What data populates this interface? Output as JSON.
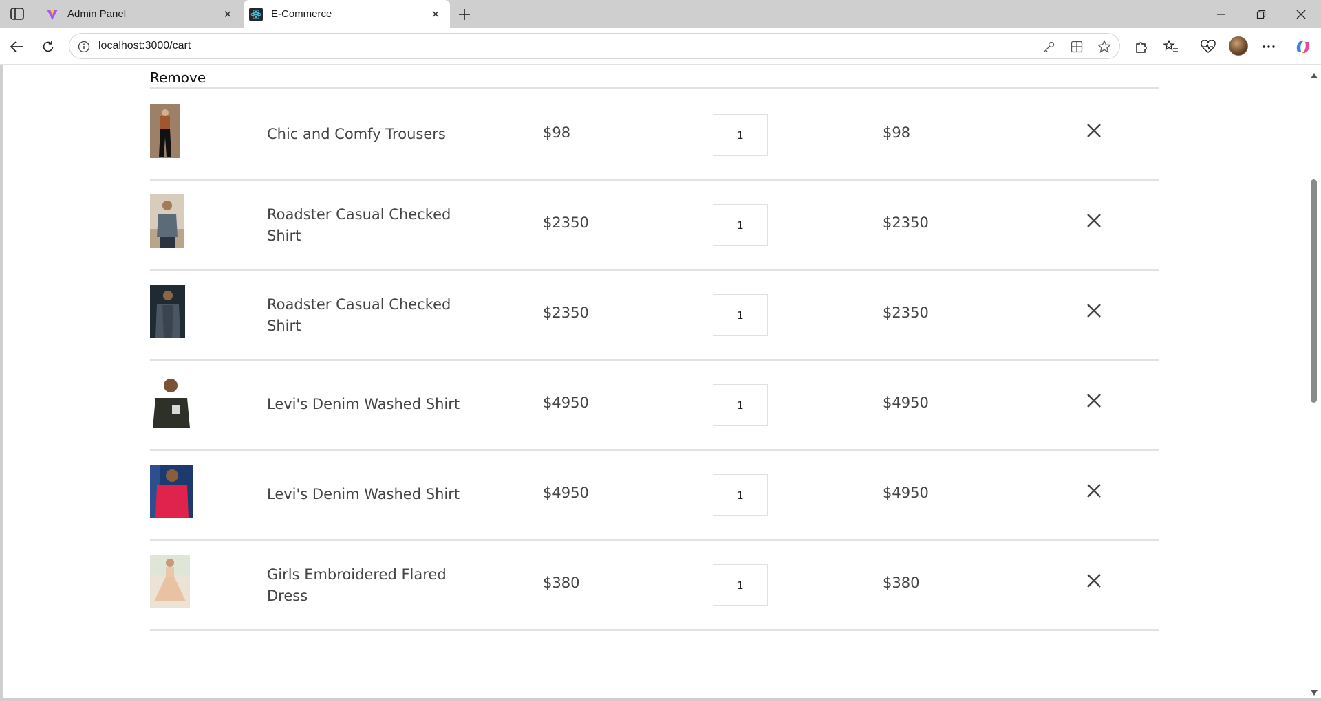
{
  "browser": {
    "tabs": [
      {
        "label": "Admin Panel",
        "favicon": "vite-logo-icon",
        "active": false
      },
      {
        "label": "E-Commerce",
        "favicon": "react-logo-icon",
        "active": true
      }
    ],
    "address": "localhost:3000/cart"
  },
  "cart": {
    "remove_header": "Remove",
    "items": [
      {
        "name": "Chic and Comfy Trousers",
        "price": "$98",
        "quantity": "1",
        "total": "$98",
        "image": "model-in-black-trousers"
      },
      {
        "name": "Roadster Casual Checked Shirt",
        "price": "$2350",
        "quantity": "1",
        "total": "$2350",
        "image": "man-in-checked-shirt"
      },
      {
        "name": "Roadster Casual Checked Shirt",
        "price": "$2350",
        "quantity": "1",
        "total": "$2350",
        "image": "man-in-checked-shirt-dark"
      },
      {
        "name": "Levi's Denim Washed Shirt",
        "price": "$4950",
        "quantity": "1",
        "total": "$4950",
        "image": "man-in-dark-tshirt"
      },
      {
        "name": "Levi's Denim Washed Shirt",
        "price": "$4950",
        "quantity": "1",
        "total": "$4950",
        "image": "man-in-red-shirt"
      },
      {
        "name": "Girls Embroidered Flared Dress",
        "price": "$380",
        "quantity": "1",
        "total": "$380",
        "image": "girl-in-flared-dress"
      }
    ]
  },
  "colors": {
    "divider": "#e2e2e2",
    "text": "#454545",
    "chrome": "#cfcfcf"
  }
}
